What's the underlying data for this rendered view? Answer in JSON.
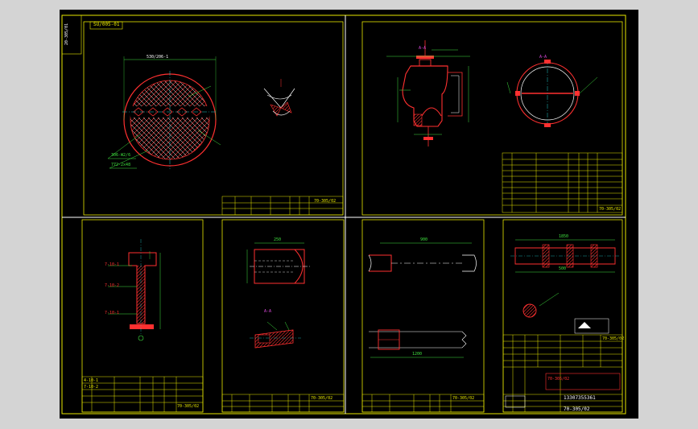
{
  "drawing": {
    "code_tag": "SU/005-01",
    "vertical_tag": "20-305/01",
    "section_mark": "A-A",
    "part_left_1": "7-10-1",
    "part_left_2": "7-10-2",
    "part_left_3": "7-10-1",
    "tb_left_row1": "4-10-1",
    "tb_left_row2": "7-10-2",
    "tb_right_code": "70-305/02",
    "title_cell": "13307355361",
    "title_code": "70-305/02",
    "top_left_dim": "530/206-1",
    "label_306": "306-W2/6",
    "label_772": "772-2x48",
    "dim_1850": "1850",
    "dim_1200": "1200",
    "dim_900": "900",
    "dim_250": "250",
    "dim_500": "500",
    "tb1_code": "70-305/02",
    "tb2_code": "70-305/02",
    "tb3_code": "70-305/02",
    "tb4_code": "70-305/02",
    "tb5_code": "70-305/02",
    "tb6_code": "70-305/02"
  },
  "colors": {
    "frame": "#e8e800",
    "part": "#ff2020",
    "dimension": "#3fe03f",
    "text": "#ffffff",
    "center": "#22c8c8"
  }
}
